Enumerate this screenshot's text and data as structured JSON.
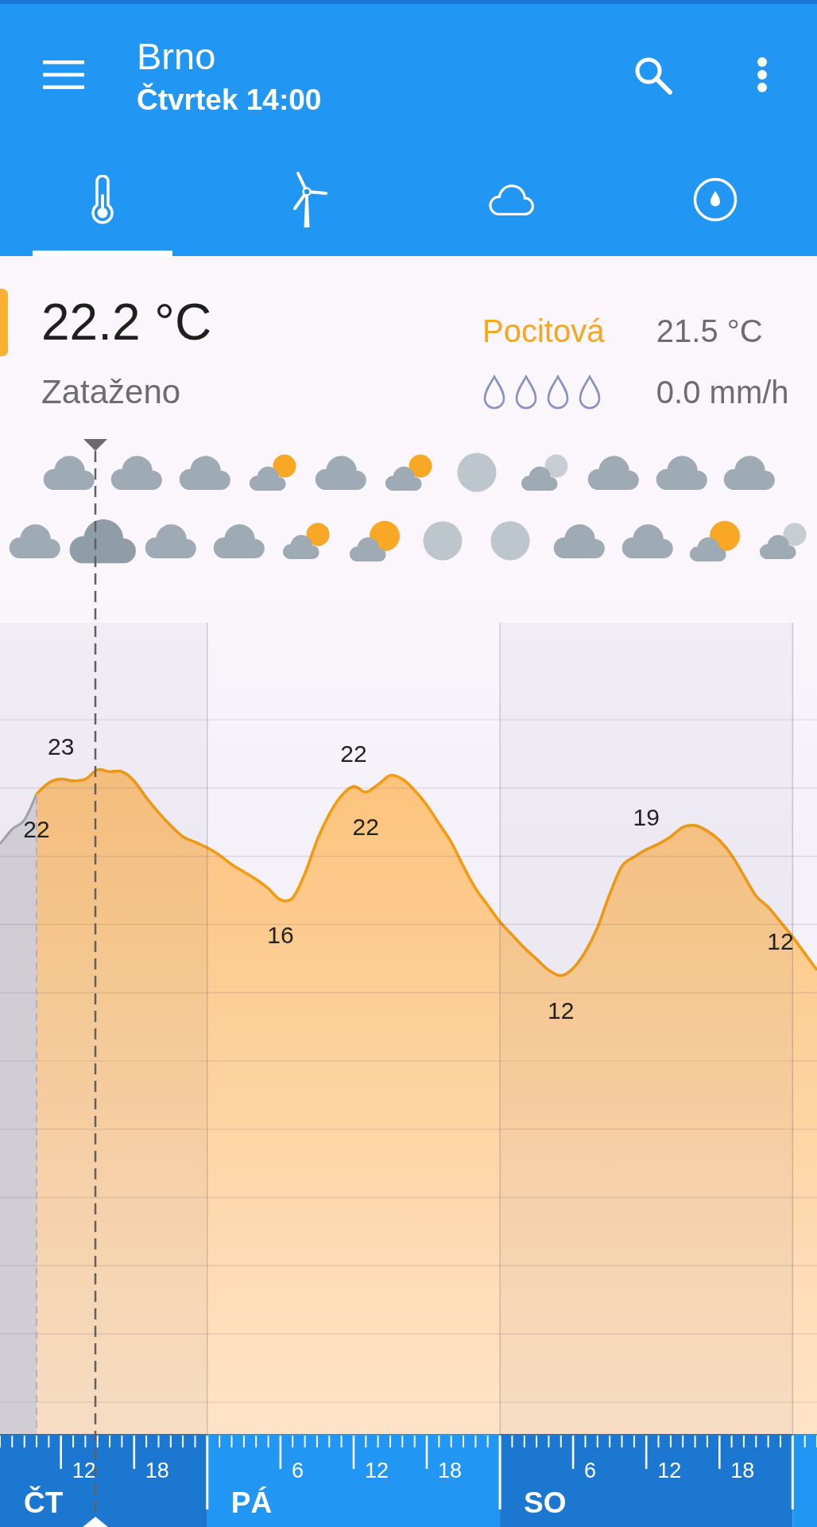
{
  "header": {
    "title": "Brno",
    "subtitle": "Čtvrtek 14:00"
  },
  "tabs": [
    {
      "kind": "temperature",
      "selected": true
    },
    {
      "kind": "wind",
      "selected": false
    },
    {
      "kind": "clouds",
      "selected": false
    },
    {
      "kind": "precipitation",
      "selected": false
    }
  ],
  "current": {
    "temperature": "22.2 °C",
    "condition": "Zataženo",
    "feels_like": {
      "label": "Pocitová",
      "value": "21.5 °C"
    },
    "precipitation": {
      "stars": 0,
      "rate": "0.0 mm/h"
    }
  },
  "icon_rows": [
    {
      "icons": [
        {
          "kind": "cloudy",
          "selected": false
        },
        {
          "kind": "cloudy",
          "selected": false
        },
        {
          "kind": "cloudy",
          "selected": false
        },
        {
          "kind": "partly-cloudy-day",
          "selected": false
        },
        {
          "kind": "cloudy",
          "selected": false
        },
        {
          "kind": "partly-cloudy-day",
          "selected": false
        },
        {
          "kind": "clear-night",
          "selected": false
        },
        {
          "kind": "partly-cloudy-night",
          "selected": false
        },
        {
          "kind": "cloudy",
          "selected": false
        },
        {
          "kind": "cloudy",
          "selected": false
        },
        {
          "kind": "cloudy",
          "selected": false
        }
      ]
    },
    {
      "icons": [
        {
          "kind": "cloudy",
          "selected": false
        },
        {
          "kind": "cloudy",
          "selected": true
        },
        {
          "kind": "cloudy",
          "selected": false
        },
        {
          "kind": "cloudy",
          "selected": false
        },
        {
          "kind": "partly-cloudy-day",
          "selected": false
        },
        {
          "kind": "mostly-sunny",
          "selected": false
        },
        {
          "kind": "clear-night",
          "selected": false
        },
        {
          "kind": "clear-night",
          "selected": false
        },
        {
          "kind": "cloudy",
          "selected": false
        },
        {
          "kind": "cloudy",
          "selected": false
        },
        {
          "kind": "mostly-sunny",
          "selected": false
        },
        {
          "kind": "partly-cloudy-night",
          "selected": false
        }
      ]
    }
  ],
  "chart": {
    "value_labels": [
      "22",
      "23",
      "16",
      "22",
      "22",
      "12",
      "19",
      "12"
    ]
  },
  "time_axis": {
    "hour_labels": [
      "12",
      "18",
      "6",
      "12",
      "18",
      "6",
      "12",
      "18"
    ],
    "day_labels": [
      "ČT",
      "PÁ",
      "SO"
    ]
  }
}
